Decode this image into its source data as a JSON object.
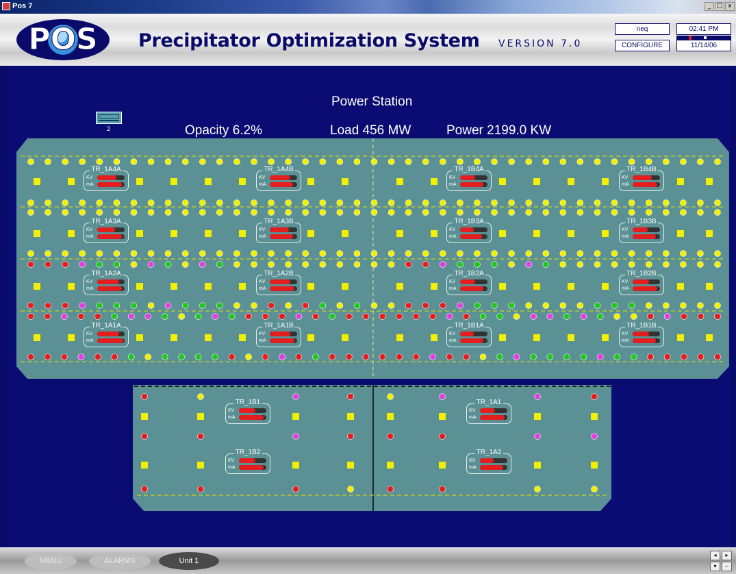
{
  "window": {
    "title": "Pos 7",
    "controls": [
      "_",
      "□",
      "x"
    ]
  },
  "header": {
    "logo_text": "POS",
    "title": "Precipitator Optimization System",
    "version": "VERSION 7.0",
    "user": "neq",
    "configure_label": "CONFIGURE",
    "time": "02:41 PM",
    "date": "11/14/06"
  },
  "overview": {
    "station": "Power Station",
    "opacity": "Opacity 6.2%",
    "load": "Load 456 MW",
    "power": "Power 2199.0 KW",
    "thumbnail_label": "2"
  },
  "labels": {
    "kv": "KV",
    "ma": "mA"
  },
  "colors": {
    "panel": "#5b9094",
    "yellow": "#f0f000",
    "red": "#e41e1e",
    "green": "#22c522",
    "magenta": "#e040e0",
    "background": "#0b0b74"
  },
  "upper_transformers": [
    {
      "name": "TR_1A4A",
      "kv": 0.7,
      "ma": 0.9
    },
    {
      "name": "TR_1A4B",
      "kv": 0.75,
      "ma": 0.85
    },
    {
      "name": "TR_1B4A",
      "kv": 0.55,
      "ma": 0.85
    },
    {
      "name": "TR_1B4B",
      "kv": 0.7,
      "ma": 0.9
    },
    {
      "name": "TR_1A3A",
      "kv": 0.65,
      "ma": 0.9
    },
    {
      "name": "TR_1A3B",
      "kv": 0.7,
      "ma": 0.85
    },
    {
      "name": "TR_1B3A",
      "kv": 0.5,
      "ma": 0.8
    },
    {
      "name": "TR_1B3B",
      "kv": 0.55,
      "ma": 0.85
    },
    {
      "name": "TR_1A2A",
      "kv": 0.8,
      "ma": 0.9
    },
    {
      "name": "TR_1A2B",
      "kv": 0.75,
      "ma": 0.9
    },
    {
      "name": "TR_1B2A",
      "kv": 0.55,
      "ma": 0.85
    },
    {
      "name": "TR_1B2B",
      "kv": 0.6,
      "ma": 0.9
    },
    {
      "name": "TR_1A1A",
      "kv": 0.8,
      "ma": 0.95
    },
    {
      "name": "TR_1A1B",
      "kv": 0.75,
      "ma": 0.9
    },
    {
      "name": "TR_1B1A",
      "kv": 0.5,
      "ma": 0.85
    },
    {
      "name": "TR_1B1B",
      "kv": 0.6,
      "ma": 0.85
    }
  ],
  "lower_transformers": [
    {
      "name": "TR_1B1",
      "kv": 0.6,
      "ma": 0.9
    },
    {
      "name": "TR_1A1",
      "kv": 0.55,
      "ma": 0.9
    },
    {
      "name": "TR_1B2",
      "kv": 0.6,
      "ma": 0.9
    },
    {
      "name": "TR_1A2",
      "kv": 0.5,
      "ma": 0.85
    }
  ],
  "upper_dot_rows": [
    "yyyyyyyyyyyyyyyyyyyyyyyyyyyyyyyyyyyyyyyyy",
    "yyyyyyyyyyyyyyyyyyyyyyyyyyyyyyyyyyyyyyyyy",
    "yyyyyyyyyyyyyyyyyyyyyyyyyyyyyyyyyyyyyyyyy",
    "yyyyyyyyyyyyyyyyyyyyyyyyyyyyyyyyyyyyyyyyy",
    "rrrmggymgymgyyyyyyyyyyrrmgggymgyyyyyyyyyy",
    "rrrmgggymgggyyryrgygyyrrrmgggyyyygggyyyyy",
    "rrmrrgmmgygmgrrrmrgrrrrrrmrggymmgmgyyrmrrr",
    "rrrmrrgyggggryrmrgrrrrrrmrrygmggggmggrrrrr"
  ],
  "lower_dot_rows": [
    "rymrymmr",
    "rrmrrrmm",
    "rrryrryy"
  ],
  "footer": {
    "menu_label": "MENU",
    "alarms_label": "ALARMS",
    "unit_label": "Unit 1"
  }
}
